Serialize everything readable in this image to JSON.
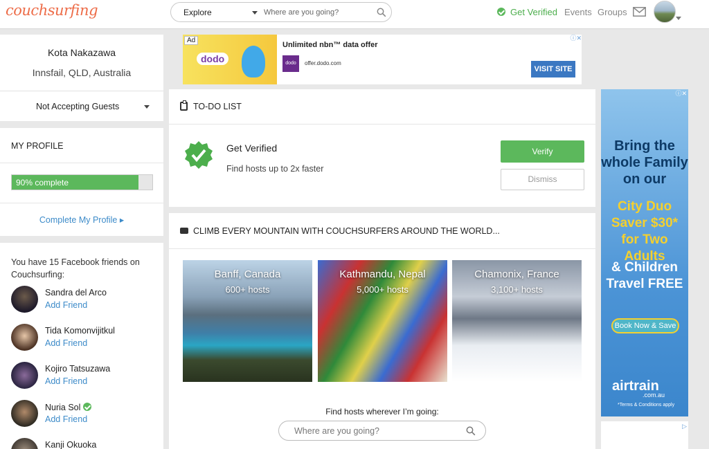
{
  "header": {
    "logo": "couchsurfing",
    "explore_label": "Explore",
    "search_placeholder": "Where are you going?",
    "get_verified": "Get Verified",
    "events": "Events",
    "groups": "Groups"
  },
  "profile": {
    "name": "Kota Nakazawa",
    "location": "Innsfail, QLD, Australia",
    "guest_status": "Not Accepting Guests"
  },
  "my_profile": {
    "title": "MY PROFILE",
    "progress_label": "90% complete",
    "progress": 0.9,
    "complete_link": "Complete My Profile ▸"
  },
  "friends": {
    "intro": "You have 15 Facebook friends on Couchsurfing:",
    "items": [
      {
        "name": "Sandra del Arco",
        "action": "Add Friend"
      },
      {
        "name": "Tida Komonvijitkul",
        "action": "Add Friend"
      },
      {
        "name": "Kojiro Tatsuzawa",
        "action": "Add Friend"
      },
      {
        "name": "Nuria Sol",
        "action": "Add Friend"
      },
      {
        "name": "Kanji Okuoka",
        "action": ""
      }
    ]
  },
  "ad_top": {
    "ad_label": "Ad",
    "brand": "dodo",
    "headline": "Unlimited nbn™ data offer",
    "url": "offer.dodo.com",
    "cta": "VISIT SITE"
  },
  "todo": {
    "title": "TO-DO LIST",
    "item_title": "Get Verified",
    "item_subtitle": "Find hosts up to 2x faster",
    "verify": "Verify",
    "dismiss": "Dismiss"
  },
  "climb": {
    "title": "CLIMB EVERY MOUNTAIN WITH COUCHSURFERS AROUND THE WORLD...",
    "destinations": [
      {
        "name": "Banff, Canada",
        "hosts": "600+ hosts"
      },
      {
        "name": "Kathmandu, Nepal",
        "hosts": "5,000+ hosts"
      },
      {
        "name": "Chamonix, France",
        "hosts": "3,100+ hosts"
      }
    ],
    "find_label": "Find hosts wherever I’m going:",
    "find_placeholder": "Where are you going?"
  },
  "ad_right": {
    "line1": "Bring the whole Family on our",
    "line2": "City Duo Saver $30* for Two Adults",
    "line3": "& Children Travel FREE",
    "cta": "Book Now & Save",
    "brand": "airtrain",
    "brand_sub": ".com.au",
    "terms": "*Terms & Conditions apply"
  },
  "colors": {
    "brand": "#ed6c48",
    "accent_green": "#5cb85c",
    "link_blue": "#3d8bc9"
  }
}
